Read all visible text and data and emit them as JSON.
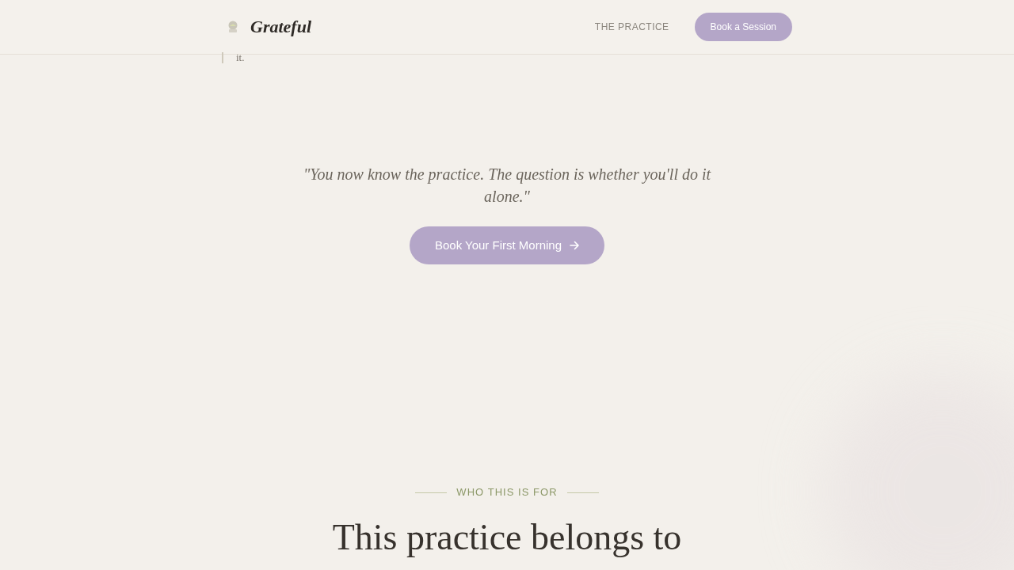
{
  "header": {
    "logo": "Grateful",
    "nav_links": [
      {
        "label": "THE PRACTICE"
      }
    ],
    "cta_button": "Book a Session"
  },
  "quote_fragment": "it.",
  "closing": {
    "quote": "\"You now know the practice. The question is whether you'll do it alone.\"",
    "button": "Book Your First Morning"
  },
  "who_section": {
    "eyebrow": "WHO THIS IS FOR",
    "heading": "This practice belongs to"
  }
}
